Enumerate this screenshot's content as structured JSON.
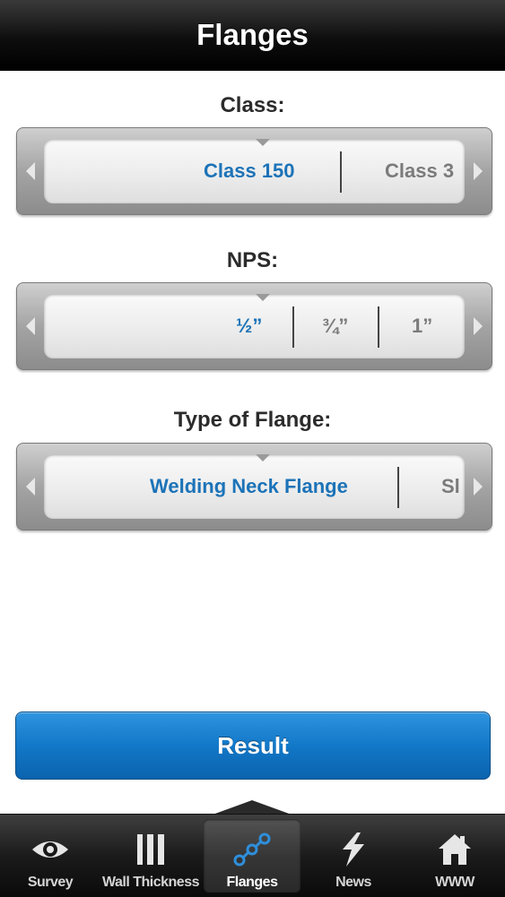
{
  "header": {
    "title": "Flanges"
  },
  "class_picker": {
    "label": "Class:",
    "selected": "Class 150",
    "next": "Class 3"
  },
  "nps_picker": {
    "label": "NPS:",
    "selected": "½”",
    "next": "¾”",
    "after": "1”"
  },
  "flange_picker": {
    "label": "Type of Flange:",
    "selected": "Welding Neck Flange",
    "next": "Sl"
  },
  "result_button": {
    "label": "Result"
  },
  "tabbar": {
    "tabs": [
      {
        "label": "Survey",
        "icon": "eye-icon"
      },
      {
        "label": "Wall Thickness",
        "icon": "bars-icon"
      },
      {
        "label": "Flanges",
        "icon": "flanges-icon",
        "active": true
      },
      {
        "label": "News",
        "icon": "lightning-icon"
      },
      {
        "label": "WWW",
        "icon": "home-icon"
      }
    ]
  },
  "colors": {
    "accent": "#1c73b8",
    "button": "#1278c8",
    "nav": "#000000"
  }
}
